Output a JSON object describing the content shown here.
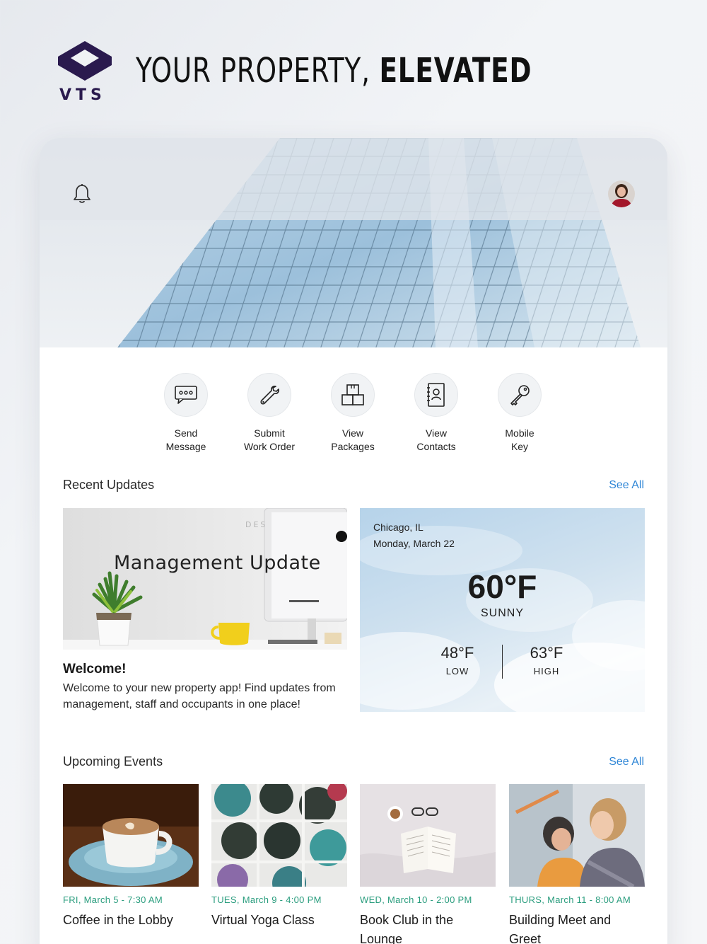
{
  "brand": {
    "logo_text": "VTS",
    "headline_regular": "YOUR PROPERTY,",
    "headline_bold": "ELEVATED",
    "brand_color": "#2a1a4e"
  },
  "topbar": {
    "notification_icon": "bell-icon",
    "avatar_icon": "user-avatar"
  },
  "quick_actions": [
    {
      "line1": "Send",
      "line2": "Message",
      "icon": "chat-bubble-icon"
    },
    {
      "line1": "Submit",
      "line2": "Work Order",
      "icon": "wrench-icon"
    },
    {
      "line1": "View",
      "line2": "Packages",
      "icon": "package-icon"
    },
    {
      "line1": "View",
      "line2": "Contacts",
      "icon": "contacts-book-icon"
    },
    {
      "line1": "Mobile",
      "line2": "Key",
      "icon": "key-icon"
    }
  ],
  "recent_updates": {
    "title": "Recent Updates",
    "see_all": "See All",
    "card": {
      "image_title": "Management Update",
      "title": "Welcome!",
      "body": "Welcome to your new property app! Find updates from management, staff and occupants in one place!"
    }
  },
  "weather": {
    "city": "Chicago, IL",
    "date": "Monday, March 22",
    "temp": "60°F",
    "condition": "SUNNY",
    "low": "48°F",
    "low_label": "LOW",
    "high": "63°F",
    "high_label": "HIGH"
  },
  "upcoming_events": {
    "title": "Upcoming Events",
    "see_all": "See All",
    "items": [
      {
        "date": "FRI, March 5 - 7:30 AM",
        "name": "Coffee in the Lobby"
      },
      {
        "date": "TUES, March 9 - 4:00 PM",
        "name": "Virtual Yoga Class"
      },
      {
        "date": "WED, March 10 - 2:00 PM",
        "name": "Book Club in the Lounge"
      },
      {
        "date": "THURS, March 11 - 8:00 AM",
        "name": "Building Meet and Greet"
      }
    ]
  },
  "colors": {
    "accent_link": "#2f86d6",
    "event_date": "#2a9d7e"
  }
}
